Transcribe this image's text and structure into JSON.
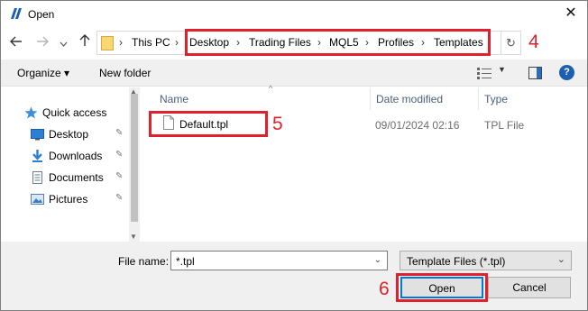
{
  "window": {
    "title": "Open",
    "close_glyph": "✕"
  },
  "nav": {
    "back_icon": "arrow-left-icon",
    "forward_icon": "arrow-right-icon",
    "dropdown_icon": "chevron-down-icon",
    "up_icon": "arrow-up-icon",
    "breadcrumbs": [
      "This PC",
      "Desktop",
      "Trading Files",
      "MQL5",
      "Profiles",
      "Templates"
    ],
    "separator": "›",
    "refresh_glyph": "↻"
  },
  "toolbar": {
    "organize_label": "Organize ▾",
    "new_folder_label": "New folder",
    "help_label": "?"
  },
  "sidebar": {
    "items": [
      {
        "label": "Quick access",
        "icon": "star-icon",
        "pinned": false
      },
      {
        "label": "Desktop",
        "icon": "desktop-icon",
        "pinned": true
      },
      {
        "label": "Downloads",
        "icon": "download-icon",
        "pinned": true
      },
      {
        "label": "Documents",
        "icon": "document-icon",
        "pinned": true
      },
      {
        "label": "Pictures",
        "icon": "picture-icon",
        "pinned": true
      }
    ],
    "pin_glyph": "📌"
  },
  "filelist": {
    "columns": [
      "Name",
      "Date modified",
      "Type"
    ],
    "rows": [
      {
        "name": "Default.tpl",
        "date": "09/01/2024 02:16",
        "type": "TPL File"
      }
    ]
  },
  "footer": {
    "filename_label": "File name:",
    "filename_value": "*.tpl",
    "filetype_value": "Template Files (*.tpl)",
    "open_label": "Open",
    "cancel_label": "Cancel"
  },
  "annotations": {
    "step_address": "4",
    "step_file": "5",
    "step_open": "6"
  },
  "colors": {
    "annotation_red": "#e0202a",
    "accent_blue": "#0078d7"
  }
}
